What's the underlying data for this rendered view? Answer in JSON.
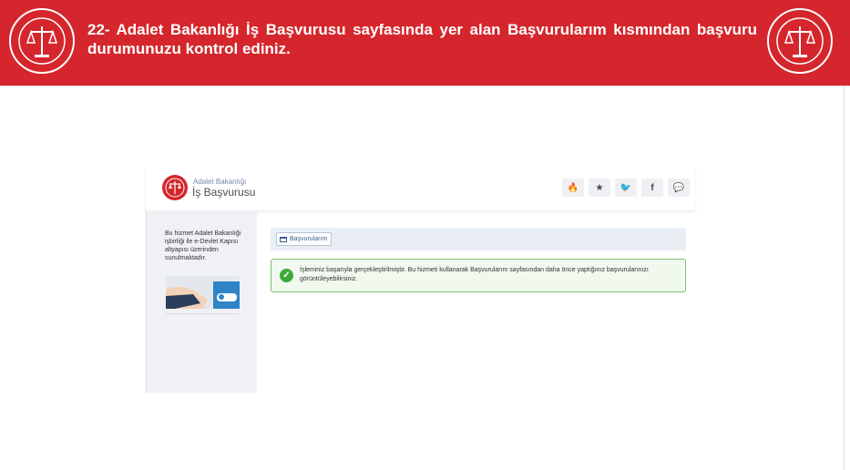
{
  "banner": {
    "title": "22- Adalet Bakanlığı İş Başvurusu sayfasında yer alan Başvurularım kısmından başvuru durumunuzu kontrol ediniz.",
    "seal_text": "TÜRKİYE CUMHURİYETİ ADALET BAKANLIĞI"
  },
  "colors": {
    "banner_red": "#d4262c",
    "success_green": "#3ea93b",
    "crumb_blue": "#3a5b8c"
  },
  "app": {
    "org_name": "Adalet Bakanlığı",
    "app_name": "İş Başvurusu",
    "header_buttons": [
      {
        "icon": "fire-icon",
        "glyph": "🔥"
      },
      {
        "icon": "star-icon",
        "glyph": "★"
      },
      {
        "icon": "twitter-icon",
        "glyph": "🐦"
      },
      {
        "icon": "facebook-icon",
        "glyph": "f"
      },
      {
        "icon": "comment-icon",
        "glyph": "💬"
      }
    ]
  },
  "sidebar": {
    "info_text": "Bu hizmet Adalet Bakanlığı işbirliği ile e-Devlet Kapısı altyapısı üzerinden sunulmaktadır."
  },
  "content": {
    "breadcrumb_label": "Başvurularım",
    "alert_icon": "check-circle-icon",
    "alert_text": "İşleminiz başarıyla gerçekleştirilmiştir. Bu hizmeti kullanarak Başvurularım sayfasından daha önce yaptığınız başvurularınızı görüntüleyebilirsiniz."
  }
}
